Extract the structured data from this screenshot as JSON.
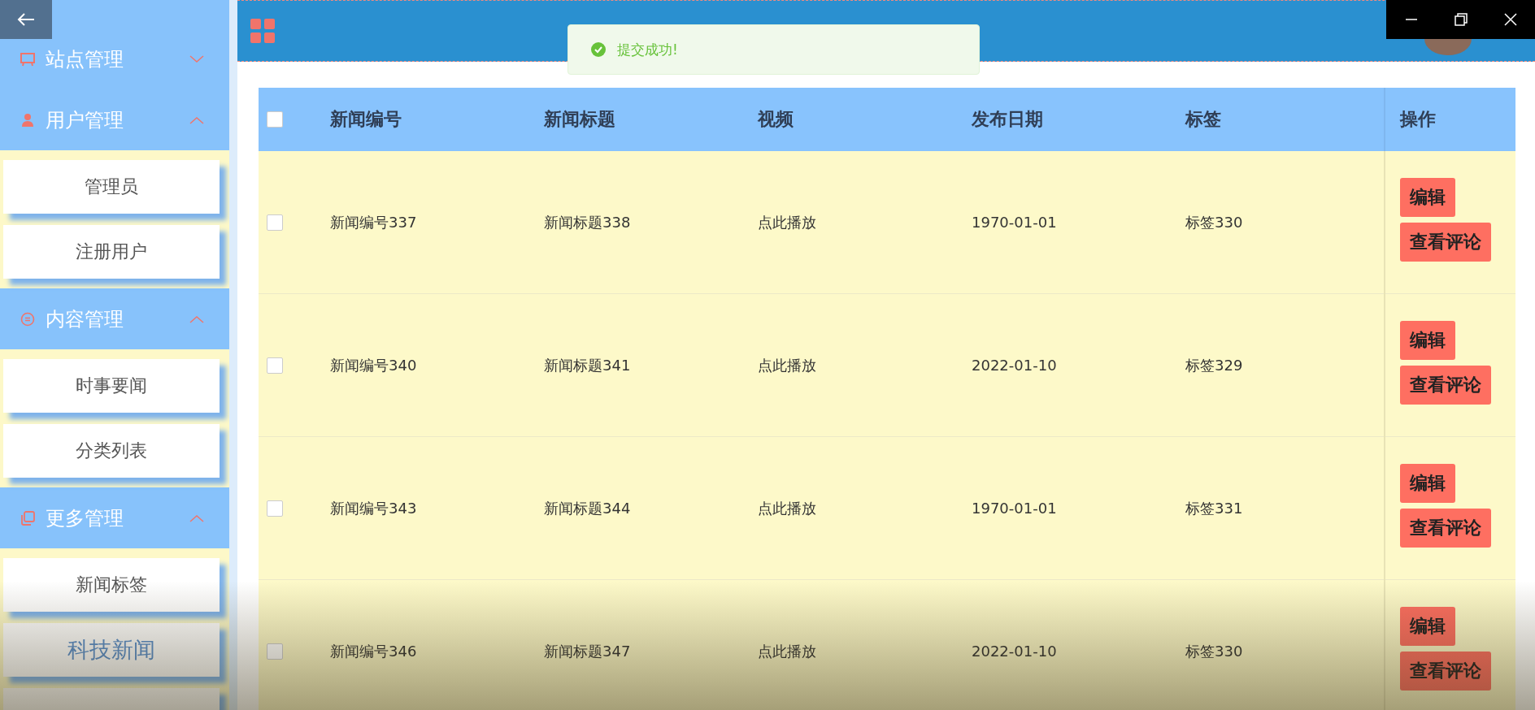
{
  "sidebar": {
    "groups": [
      {
        "label": "站点管理",
        "kind": "monitor",
        "expanded": false
      },
      {
        "label": "用户管理",
        "kind": "user",
        "expanded": true,
        "children": [
          {
            "label": "管理员",
            "selected": false
          },
          {
            "label": "注册用户",
            "selected": false
          }
        ]
      },
      {
        "label": "内容管理",
        "kind": "chat",
        "expanded": true,
        "children": [
          {
            "label": "时事要闻",
            "selected": false
          },
          {
            "label": "分类列表",
            "selected": false
          }
        ]
      },
      {
        "label": "更多管理",
        "kind": "copy",
        "expanded": true,
        "children": [
          {
            "label": "新闻标签",
            "selected": false
          },
          {
            "label": "科技新闻",
            "selected": true
          }
        ]
      }
    ]
  },
  "toast": {
    "kind": "success",
    "message": "提交成功!"
  },
  "table": {
    "select_all": {
      "checked": false
    },
    "columns": [
      "新闻编号",
      "新闻标题",
      "视频",
      "发布日期",
      "标签",
      "操作"
    ],
    "rows": [
      {
        "checked": false,
        "cells": [
          "新闻编号337",
          "新闻标题338",
          "点此播放",
          "1970-01-01",
          "标签330"
        ],
        "actions": [
          "编辑",
          "查看评论"
        ]
      },
      {
        "checked": false,
        "cells": [
          "新闻编号340",
          "新闻标题341",
          "点此播放",
          "2022-01-10",
          "标签329"
        ],
        "actions": [
          "编辑",
          "查看评论"
        ]
      },
      {
        "checked": false,
        "cells": [
          "新闻编号343",
          "新闻标题344",
          "点此播放",
          "1970-01-01",
          "标签331"
        ],
        "actions": [
          "编辑",
          "查看评论"
        ]
      },
      {
        "checked": false,
        "cells": [
          "新闻编号346",
          "新闻标题347",
          "点此播放",
          "2022-01-10",
          "标签330"
        ],
        "actions": [
          "编辑",
          "查看评论"
        ]
      }
    ]
  }
}
